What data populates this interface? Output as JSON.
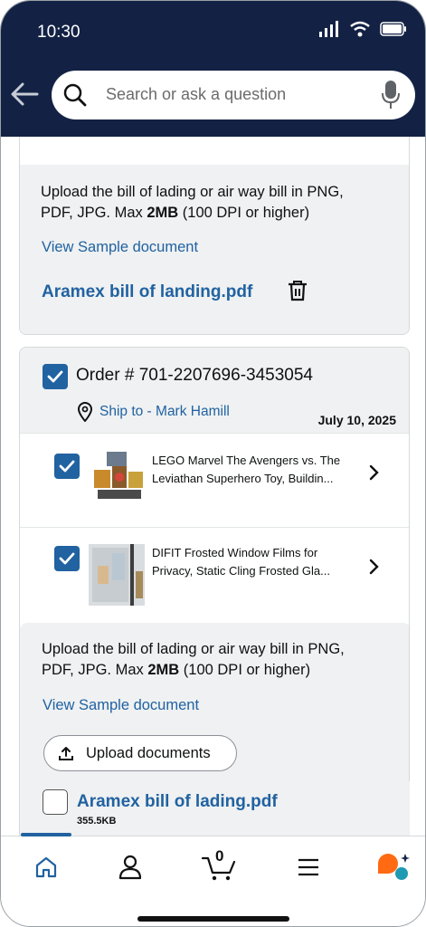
{
  "status_bar": {
    "time": "10:30"
  },
  "search": {
    "placeholder": "Search or ask a question"
  },
  "upload_card_1": {
    "instruction_line1": "Upload the bill of lading or air way bill in PNG,",
    "instruction_line2_a": "PDF, JPG. Max ",
    "instruction_line2_b": "2MB",
    "instruction_line2_c": " (100 DPI or higher)",
    "sample_link": "View Sample document",
    "file_name": "Aramex bill of landing.pdf"
  },
  "order": {
    "title": "Order # 701-2207696-3453054",
    "ship_to": "Ship to - Mark Hamill",
    "date": "July 10, 2025",
    "items": [
      {
        "title_line1": "LEGO Marvel The Avengers vs. The",
        "title_line2": "Leviathan Superhero Toy, Buildin..."
      },
      {
        "title_line1": "DIFIT Frosted Window Films for",
        "title_line2": "Privacy, Static Cling Frosted Gla..."
      }
    ]
  },
  "upload_card_2": {
    "instruction_line1": "Upload the bill of lading or air way bill in PNG,",
    "instruction_line2_a": "PDF, JPG. Max ",
    "instruction_line2_b": "2MB",
    "instruction_line2_c": " (100 DPI or higher)",
    "sample_link": "View Sample document",
    "upload_button": "Upload documents",
    "file_name": "Aramex bill of lading.pdf",
    "file_size": "355.5KB"
  },
  "bottom_nav": {
    "cart_count": "0"
  },
  "colors": {
    "header": "#132244",
    "link": "#2162a1",
    "panel": "#eff1f2",
    "accent": "#ff6a13"
  }
}
